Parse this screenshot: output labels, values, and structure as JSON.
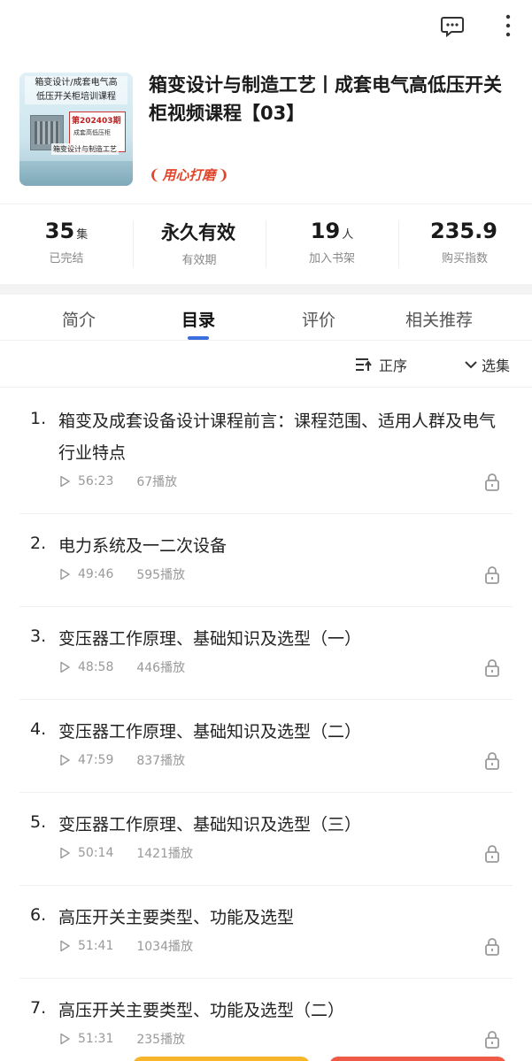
{
  "header": {
    "message_icon": "message-dots-icon",
    "more_icon": "more-vertical-icon"
  },
  "course": {
    "title": "箱变设计与制造工艺丨成套电气高低压开关柜视频课程【03】",
    "badge": "用心打磨",
    "cover": {
      "line1": "箱变设计/成套电气高",
      "line2": "低压开关柜培训课程",
      "issue": "第202403期",
      "sub": "成套高低压柜",
      "foot": "箱变设计与制造工艺"
    }
  },
  "stats": [
    {
      "value": "35",
      "unit": "集",
      "label": "已完结"
    },
    {
      "value": "永久有效",
      "unit": "",
      "label": "有效期"
    },
    {
      "value": "19",
      "unit": "人",
      "label": "加入书架"
    },
    {
      "value": "235.9",
      "unit": "",
      "label": "购买指数"
    }
  ],
  "tabs": [
    {
      "label": "简介",
      "active": false
    },
    {
      "label": "目录",
      "active": true
    },
    {
      "label": "评价",
      "active": false
    },
    {
      "label": "相关推荐",
      "active": false
    }
  ],
  "toolbar": {
    "sort_label": "正序",
    "select_label": "选集"
  },
  "episodes": [
    {
      "num": "1.",
      "title": "箱变及成套设备设计课程前言：课程范围、适用人群及电气行业特点",
      "duration": "56:23",
      "plays": "67播放"
    },
    {
      "num": "2.",
      "title": "电力系统及一二次设备",
      "duration": "49:46",
      "plays": "595播放"
    },
    {
      "num": "3.",
      "title": "变压器工作原理、基础知识及选型（一）",
      "duration": "48:58",
      "plays": "446播放"
    },
    {
      "num": "4.",
      "title": "变压器工作原理、基础知识及选型（二）",
      "duration": "47:59",
      "plays": "837播放"
    },
    {
      "num": "5.",
      "title": "变压器工作原理、基础知识及选型（三）",
      "duration": "50:14",
      "plays": "1421播放"
    },
    {
      "num": "6.",
      "title": "高压开关主要类型、功能及选型",
      "duration": "51:41",
      "plays": "1034播放"
    },
    {
      "num": "7.",
      "title": "高压开关主要类型、功能及选型（二）",
      "duration": "51:31",
      "plays": "235播放"
    }
  ],
  "colors": {
    "accent": "#3b6fe0",
    "badge_red": "#e0442a"
  }
}
